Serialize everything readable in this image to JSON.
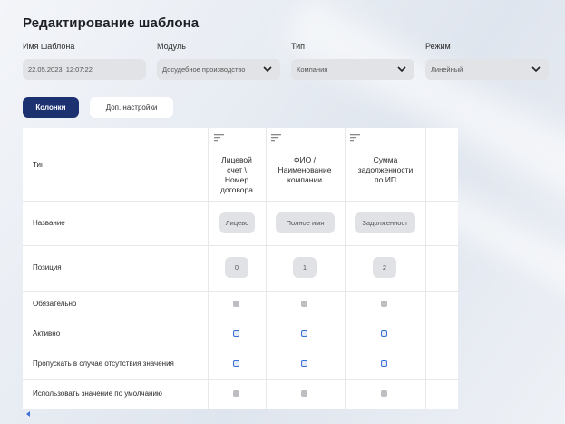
{
  "page": {
    "title": "Редактирование шаблона"
  },
  "form": {
    "name_label": "Имя шаблона",
    "name_value": "22.05.2023, 12:07:22",
    "module_label": "Модуль",
    "module_value": "Досудебное производство",
    "type_label": "Тип",
    "type_value": "Компания",
    "mode_label": "Режим",
    "mode_value": "Линейный"
  },
  "tabs": {
    "columns": "Колонки",
    "extra": "Доп. настройки"
  },
  "table": {
    "row_labels": {
      "type": "Тип",
      "name": "Название",
      "position": "Позиция",
      "required": "Обязательно",
      "active": "Активно",
      "skip": "Пропускать в случае отсутствия значения",
      "default": "Использовать значение по умолчанию"
    },
    "columns": [
      {
        "header": "Лицевой\nсчет \\\nНомер\nдоговора",
        "name": "Лицево",
        "position": "0",
        "required": false,
        "active": true,
        "skip": true,
        "default": false
      },
      {
        "header": "ФИО /\nНаименование\nкомпании",
        "name": "Полное имя",
        "position": "1",
        "required": false,
        "active": true,
        "skip": true,
        "default": false
      },
      {
        "header": "Сумма\nзадолженности\nпо ИП",
        "name": "Задолженност",
        "position": "2",
        "required": false,
        "active": true,
        "skip": true,
        "default": false
      }
    ]
  },
  "icons": {
    "dropdown": "chevron-down-icon",
    "sort": "sort-lines-icon",
    "scroll": "triangle-left-icon"
  },
  "colors": {
    "accent": "#1c3170",
    "checkbox_on": "#3b6fd6",
    "field_bg": "#e2e3e6"
  }
}
